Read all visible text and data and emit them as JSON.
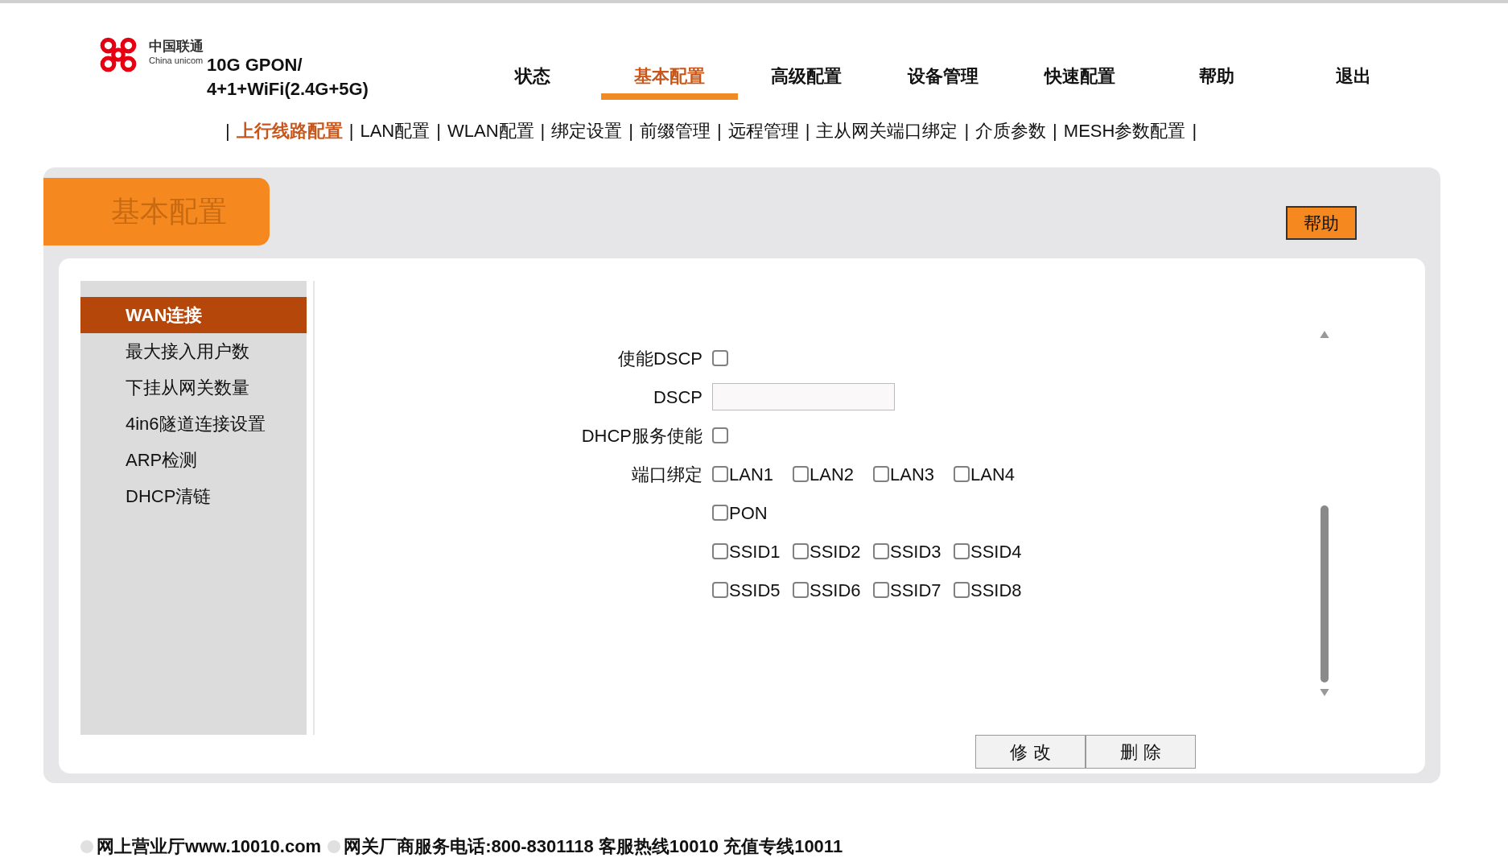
{
  "header": {
    "brand_cn": "中国联通",
    "brand_en": "China unicom",
    "model": [
      "10G GPON/",
      "4+1+WiFi(2.4G+5G)"
    ]
  },
  "nav": [
    {
      "label": "状态",
      "selected": false
    },
    {
      "label": "基本配置",
      "selected": true
    },
    {
      "label": "高级配置",
      "selected": false
    },
    {
      "label": "设备管理",
      "selected": false
    },
    {
      "label": "快速配置",
      "selected": false
    },
    {
      "label": "帮助",
      "selected": false
    },
    {
      "label": "退出",
      "selected": false
    }
  ],
  "subnav": {
    "separator": "|",
    "items": [
      {
        "label": "上行线路配置",
        "selected": true
      },
      {
        "label": "LAN配置",
        "selected": false
      },
      {
        "label": "WLAN配置",
        "selected": false
      },
      {
        "label": "绑定设置",
        "selected": false
      },
      {
        "label": "前缀管理",
        "selected": false
      },
      {
        "label": "远程管理",
        "selected": false
      },
      {
        "label": "主从网关端口绑定",
        "selected": false
      },
      {
        "label": "介质参数",
        "selected": false
      },
      {
        "label": "MESH参数配置",
        "selected": false
      }
    ]
  },
  "panel": {
    "title": "基本配置",
    "help_button": "帮助"
  },
  "sidebar": {
    "items": [
      {
        "label": "WAN连接",
        "selected": true
      },
      {
        "label": "最大接入用户数",
        "selected": false
      },
      {
        "label": "下挂从网关数量",
        "selected": false
      },
      {
        "label": "4in6隧道连接设置",
        "selected": false
      },
      {
        "label": "ARP检测",
        "selected": false
      },
      {
        "label": "DHCP清链",
        "selected": false
      }
    ]
  },
  "form": {
    "rows": [
      {
        "kind": "checkbox",
        "label": "使能DSCP",
        "checked": false
      },
      {
        "kind": "input",
        "label": "DSCP",
        "value": ""
      },
      {
        "kind": "checkbox",
        "label": "DHCP服务使能",
        "checked": false
      },
      {
        "kind": "options",
        "label": "端口绑定",
        "lines": [
          [
            {
              "label": "LAN1",
              "checked": false
            },
            {
              "label": "LAN2",
              "checked": false
            },
            {
              "label": "LAN3",
              "checked": false
            },
            {
              "label": "LAN4",
              "checked": false
            }
          ],
          [
            {
              "label": "PON",
              "checked": false
            }
          ],
          [
            {
              "label": "SSID1",
              "checked": false
            },
            {
              "label": "SSID2",
              "checked": false
            },
            {
              "label": "SSID3",
              "checked": false
            },
            {
              "label": "SSID4",
              "checked": false
            }
          ],
          [
            {
              "label": "SSID5",
              "checked": false
            },
            {
              "label": "SSID6",
              "checked": false
            },
            {
              "label": "SSID7",
              "checked": false
            },
            {
              "label": "SSID8",
              "checked": false
            }
          ]
        ]
      }
    ]
  },
  "buttons": [
    "修 改",
    "删 除"
  ],
  "footer": [
    "网上营业厅www.10010.com",
    "网关厂商服务电话:800-8301118 客服热线10010 充值专线10011"
  ]
}
